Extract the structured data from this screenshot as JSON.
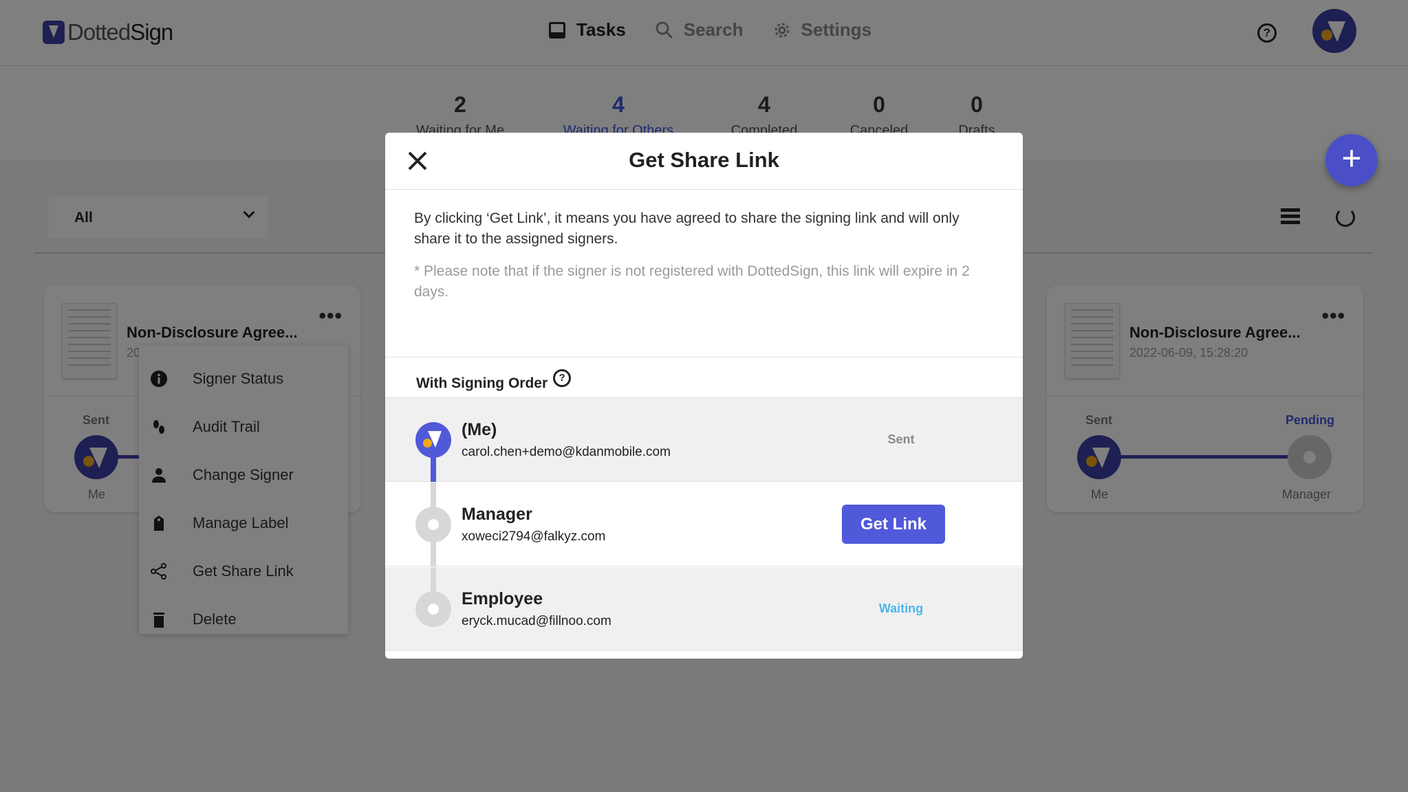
{
  "app": {
    "logo_prefix": "Dotted",
    "logo_suffix": "Sign"
  },
  "nav": {
    "tasks": "Tasks",
    "search": "Search",
    "settings": "Settings",
    "help_glyph": "?"
  },
  "status_tabs": [
    {
      "count": "2",
      "label": "Waiting for Me"
    },
    {
      "count": "4",
      "label": "Waiting for Others"
    },
    {
      "count": "4",
      "label": "Completed"
    },
    {
      "count": "0",
      "label": "Canceled"
    },
    {
      "count": "0",
      "label": "Drafts"
    }
  ],
  "fab": {
    "glyph": "+"
  },
  "filter": {
    "value": "All"
  },
  "cards": [
    {
      "title": "Non-Disclosure Agree...",
      "date": "20",
      "more": "•••",
      "first_status": "Sent",
      "first_who": "Me"
    },
    {
      "title": "Non-Disclosure Agree...",
      "date": "2022-06-09, 15:28:20",
      "more": "•••",
      "first_status": "Sent",
      "first_who": "Me",
      "second_status": "Pending",
      "second_who": "Manager"
    }
  ],
  "context_menu": [
    {
      "label": "Signer Status",
      "icon": "info-icon",
      "glyph": "i"
    },
    {
      "label": "Audit Trail",
      "icon": "footprints-icon",
      "glyph": "⁘"
    },
    {
      "label": "Change Signer",
      "icon": "person-swap-icon",
      "glyph": "⚇"
    },
    {
      "label": "Manage Label",
      "icon": "tag-icon",
      "glyph": "▮"
    },
    {
      "label": "Get Share Link",
      "icon": "share-icon",
      "glyph": "<"
    },
    {
      "label": "Delete",
      "icon": "trash-icon",
      "glyph": "▮"
    }
  ],
  "modal": {
    "title": "Get Share Link",
    "description": "By clicking ‘Get Link’, it means you have agreed to share the signing link and will only share it to the assigned signers.",
    "note": "* Please note that if the signer is not registered with DottedSign, this link will expire in 2 days.",
    "order_heading": "With Signing Order",
    "order_help_glyph": "?",
    "signers": [
      {
        "name": "(Me)",
        "email": "carol.chen+demo@kdanmobile.com",
        "status": "Sent"
      },
      {
        "name": "Manager",
        "email": "xoweci2794@falkyz.com",
        "action": "Get Link"
      },
      {
        "name": "Employee",
        "email": "eryck.mucad@fillnoo.com",
        "status": "Waiting"
      }
    ]
  },
  "colors": {
    "accent": "#3d3fa4",
    "button": "#5059d9",
    "active_tab": "#3d57d8",
    "waiting": "#4fb6e8",
    "avatar_dot": "#f0a818"
  }
}
